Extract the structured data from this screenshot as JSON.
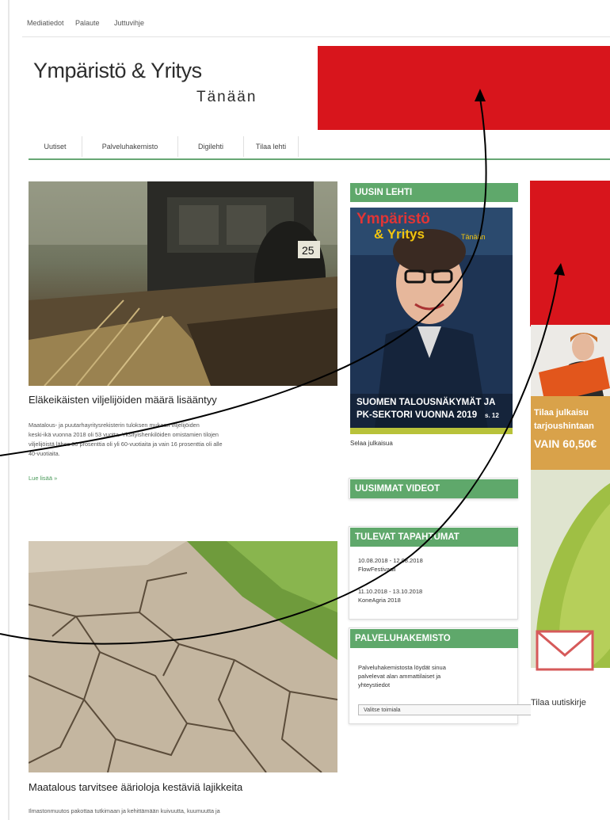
{
  "utility_nav": [
    "Mediatiedot",
    "Palaute",
    "Juttuvihje"
  ],
  "logo": {
    "main": "Ympäristö & Yritys",
    "sub": "Tänään"
  },
  "main_nav": [
    "Uutiset",
    "Palveluhakemisto",
    "Digilehti",
    "Tilaa lehti"
  ],
  "articles": [
    {
      "title": "Eläkeikäisten viljelijöiden määrä lisääntyy",
      "excerpt_lines": [
        "Maatalous- ja puutarhayritysrekisterin tuloksen mukaan viljelijöiden",
        "keski-ikä vuonna 2018 oli 53 vuotta. Yksityishenkilöiden omistamien tilojen",
        "viljelijöistä lähes 30 prosenttia oli yli 60-vuotiaita ja vain 16 prosenttia oli alle",
        "40-vuotiaita."
      ],
      "read_more": "Lue lisää »"
    },
    {
      "title": "Maatalous tarvitsee äärioloja kestäviä lajikkeita",
      "excerpt_lines": [
        "Ilmastonmuutos pakottaa tutkimaan ja kehittämään kuivuutta, kuumuutta ja"
      ]
    }
  ],
  "sidebar": {
    "latest_issue": {
      "heading": "UUSIN LEHTI",
      "cover_title_1": "Ympäristö",
      "cover_title_2": "& Yritys",
      "cover_title_3": "Tänään",
      "cover_headline_1": "SUOMEN TALOUSNÄKYMÄT JA",
      "cover_headline_2": "PK-SEKTORI VUONNA 2019",
      "cover_page": "s. 12",
      "browse_link": "Selaa julkaisua"
    },
    "videos": {
      "heading": "UUSIMMAT VIDEOT"
    },
    "events": {
      "heading": "TULEVAT TAPAHTUMAT",
      "items": [
        {
          "dates": "10.08.2018 - 12.08.2018",
          "name": "FlowFestivaali"
        },
        {
          "dates": "11.10.2018 - 13.10.2018",
          "name": "KoneAgria 2018"
        }
      ]
    },
    "directory": {
      "heading": "PALVELUHAKEMISTO",
      "text_lines": [
        "Palveluhakemistosta löydät sinua",
        "palvelevat alan ammattilaiset ja",
        "yhteystiedot"
      ],
      "select_value": "Valitse toimiala"
    }
  },
  "ads": {
    "subscribe_line_1": "Tilaa julkaisu",
    "subscribe_line_2": "tarjoushintaan",
    "subscribe_price": "VAIN 60,50€",
    "newsletter": "Tilaa uutiskirje"
  },
  "colors": {
    "accent_green": "#5fa86b",
    "banner_red": "#d8151c",
    "arrow": "#000000"
  }
}
